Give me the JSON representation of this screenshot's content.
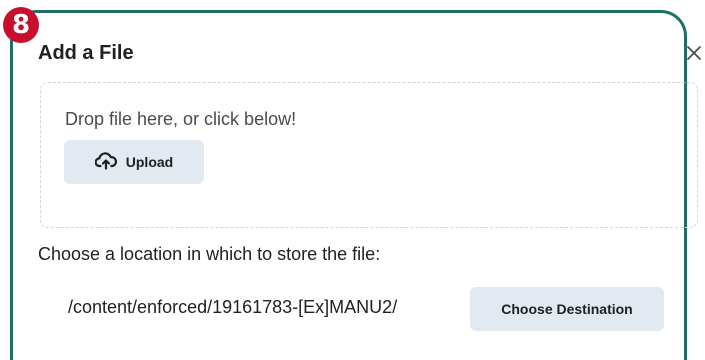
{
  "badge": {
    "number": "8"
  },
  "dialog": {
    "title": "Add a File",
    "close_icon": "close-icon"
  },
  "drop_zone": {
    "instruction": "Drop file here, or click below!",
    "upload_label": "Upload",
    "upload_icon": "cloud-upload-icon"
  },
  "location": {
    "label": "Choose a location in which to store the file:",
    "path": "/content/enforced/19161783-[Ex]MANU2/",
    "choose_button_label": "Choose Destination"
  },
  "colors": {
    "frame_border": "#1f6f67",
    "badge": "#c8102e",
    "button_bg": "#e3e9f1",
    "dashed_border": "#cdd5dc"
  }
}
